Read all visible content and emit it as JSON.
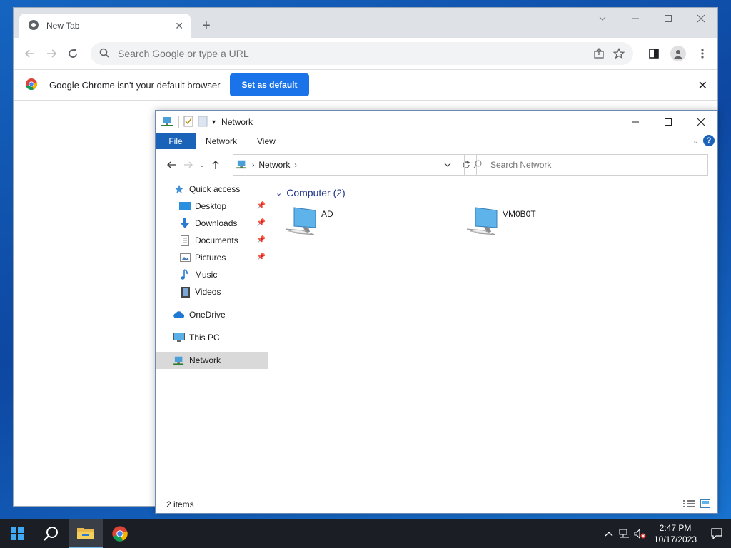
{
  "chrome": {
    "tab_title": "New Tab",
    "omnibox_placeholder": "Search Google or type a URL",
    "infobar_message": "Google Chrome isn't your default browser",
    "set_default_label": "Set as default"
  },
  "explorer": {
    "title": "Network",
    "ribbon_tabs": [
      "File",
      "Network",
      "View"
    ],
    "address_crumb": "Network",
    "search_placeholder": "Search Network",
    "nav": {
      "quick_access": "Quick access",
      "desktop": "Desktop",
      "downloads": "Downloads",
      "documents": "Documents",
      "pictures": "Pictures",
      "music": "Music",
      "videos": "Videos",
      "onedrive": "OneDrive",
      "this_pc": "This PC",
      "network": "Network"
    },
    "group_header": "Computer (2)",
    "computers": [
      "AD",
      "VM0B0T"
    ],
    "status": "2 items"
  },
  "taskbar": {
    "time": "2:47 PM",
    "date": "10/17/2023"
  },
  "colors": {
    "chrome_blue": "#1a73e8",
    "explorer_file_tab": "#1a63b8",
    "taskbar": "#1b1f25"
  }
}
